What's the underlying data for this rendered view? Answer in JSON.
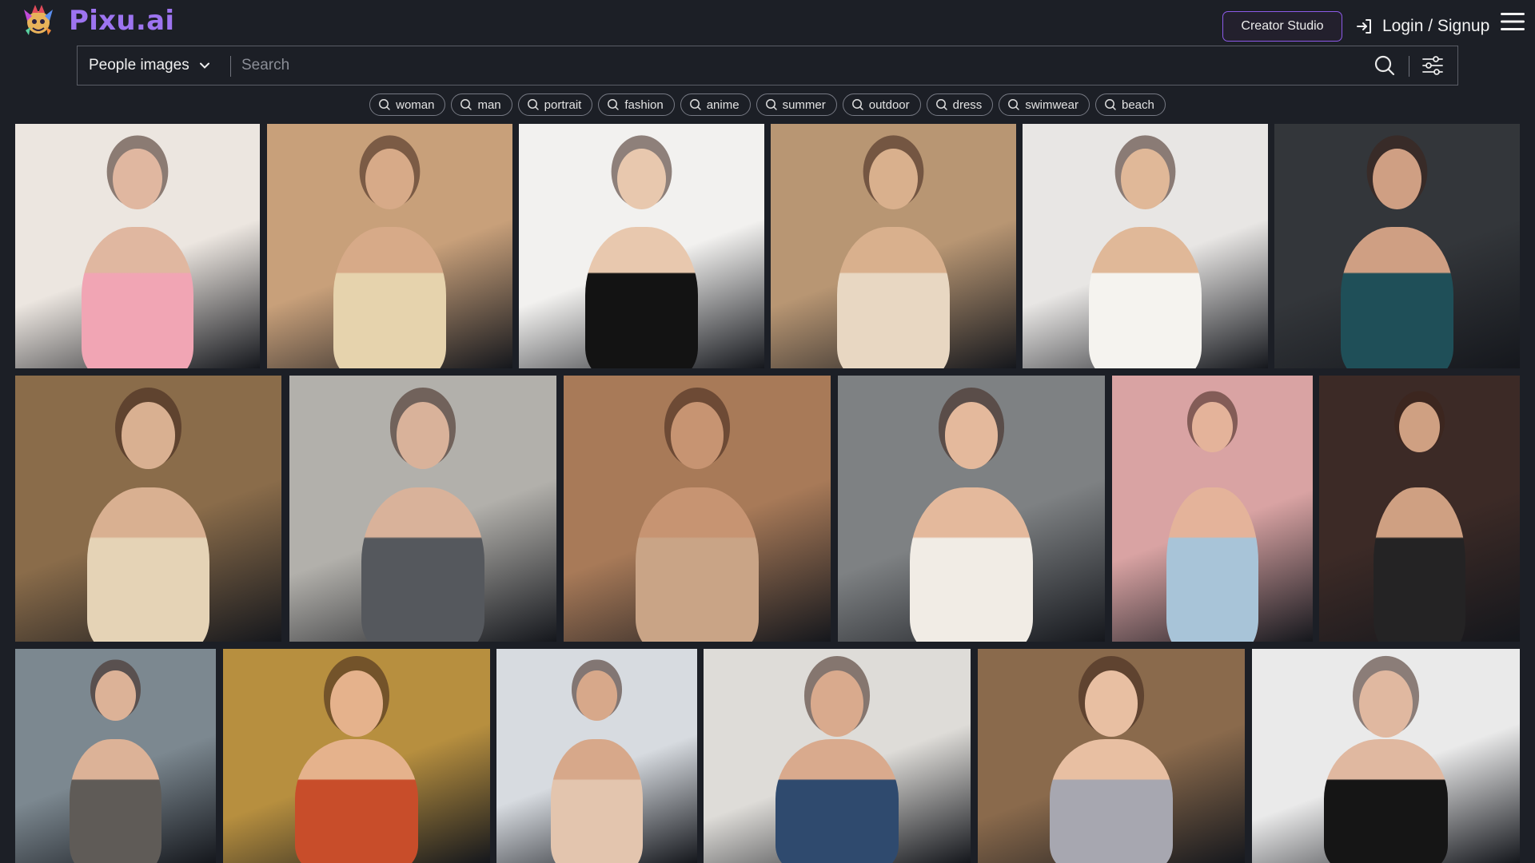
{
  "app": {
    "name": "Pixu.ai",
    "brand_color": "#9d74f0",
    "accent_border": "#8c5ae8"
  },
  "header": {
    "creator_studio_label": "Creator Studio",
    "login_label": "Login / Signup",
    "login_icon": "login-icon",
    "menu_icon": "hamburger-menu-icon"
  },
  "search": {
    "category_selected": "People images",
    "placeholder": "Search",
    "value": "",
    "search_icon": "search-icon",
    "filter_icon": "sliders-filter-icon"
  },
  "tags": [
    "woman",
    "man",
    "portrait",
    "fashion",
    "anime",
    "summer",
    "outdoor",
    "dress",
    "swimwear",
    "beach"
  ],
  "gallery": {
    "rows": [
      {
        "tiles": [
          {
            "bg": "#ece6e0",
            "tone": "#e0b7a0",
            "accent": "#f1a5b4"
          },
          {
            "bg": "#c8a07a",
            "tone": "#d7aa88",
            "accent": "#e6d3ad"
          },
          {
            "bg": "#f2f1ef",
            "tone": "#e8c8ae",
            "accent": "#131313"
          },
          {
            "bg": "#b89673",
            "tone": "#d9b08d",
            "accent": "#e8d7c2"
          },
          {
            "bg": "#e8e6e4",
            "tone": "#e0b898",
            "accent": "#f5f3ef"
          },
          {
            "bg": "#33363a",
            "tone": "#cf9f83",
            "accent": "#1f4f58"
          }
        ]
      },
      {
        "tiles": [
          {
            "bg": "#8a6c4a",
            "tone": "#d9b091",
            "accent": "#e5d3b6"
          },
          {
            "bg": "#b2b0ab",
            "tone": "#d9b29a",
            "accent": "#55585d"
          },
          {
            "bg": "#a87a58",
            "tone": "#c79472",
            "accent": "#c9a486"
          },
          {
            "bg": "#7e8183",
            "tone": "#e4b99c",
            "accent": "#f1ece5"
          },
          {
            "bg": "#d9a3a3",
            "tone": "#e4b39a",
            "accent": "#a8c4d8"
          },
          {
            "bg": "#3c2a26",
            "tone": "#cfa082",
            "accent": "#242324"
          }
        ]
      },
      {
        "tiles": [
          {
            "bg": "#7c8890",
            "tone": "#dcb297",
            "accent": "#5f5b57"
          },
          {
            "bg": "#b78f3f",
            "tone": "#e5b28c",
            "accent": "#c84d2a"
          },
          {
            "bg": "#d7dbe0",
            "tone": "#d7a88a",
            "accent": "#e3c5ae"
          },
          {
            "bg": "#dedcd8",
            "tone": "#d9aa8d",
            "accent": "#2f4a6e"
          },
          {
            "bg": "#8a6a4c",
            "tone": "#e8bfa2",
            "accent": "#a7a7b0"
          },
          {
            "bg": "#eaeaea",
            "tone": "#e0b8a0",
            "accent": "#151515"
          }
        ]
      }
    ]
  }
}
